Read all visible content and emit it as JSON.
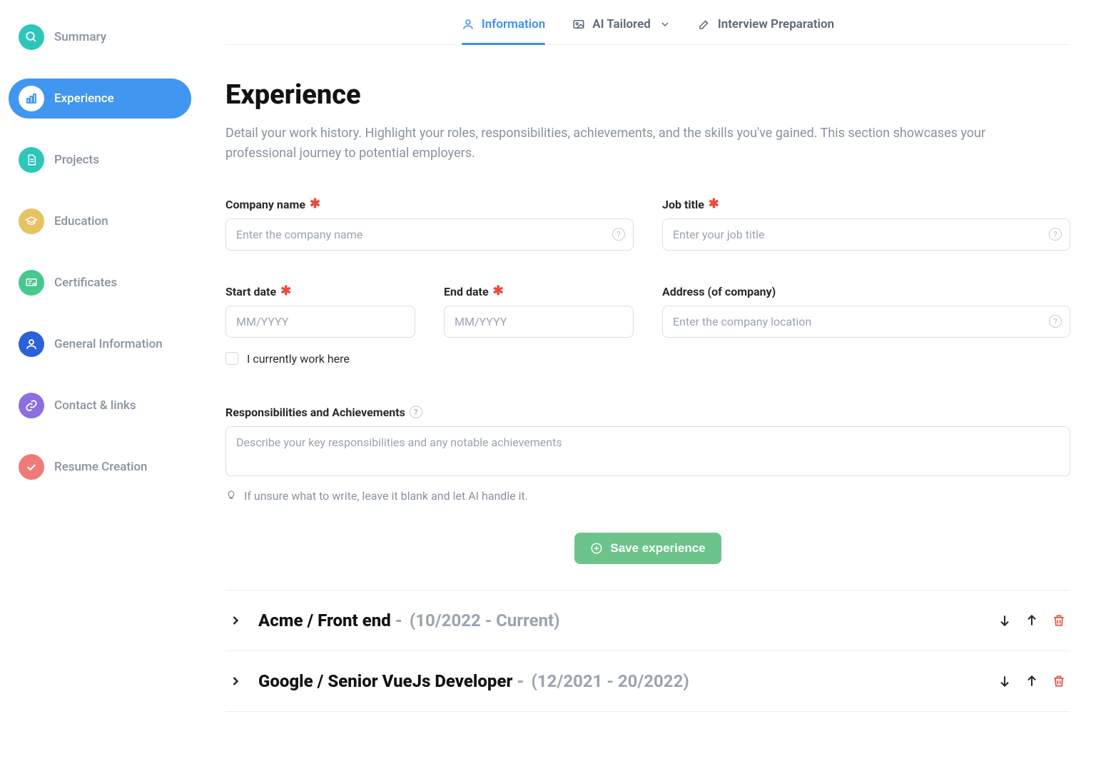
{
  "sidebar": {
    "items": [
      {
        "label": "Summary",
        "icon": "search-icon",
        "color": "bg-teal",
        "active": false
      },
      {
        "label": "Experience",
        "icon": "chart-icon",
        "color": "bg-blue",
        "active": true
      },
      {
        "label": "Projects",
        "icon": "document-icon",
        "color": "bg-teal",
        "active": false
      },
      {
        "label": "Education",
        "icon": "graduation-icon",
        "color": "bg-yellow",
        "active": false
      },
      {
        "label": "Certificates",
        "icon": "certificate-icon",
        "color": "bg-green",
        "active": false
      },
      {
        "label": "General Information",
        "icon": "person-icon",
        "color": "bg-indigo",
        "active": false
      },
      {
        "label": "Contact & links",
        "icon": "link-icon",
        "color": "bg-purple",
        "active": false
      },
      {
        "label": "Resume Creation",
        "icon": "check-icon",
        "color": "bg-coral",
        "active": false
      }
    ]
  },
  "tabs": [
    {
      "label": "Information",
      "active": true
    },
    {
      "label": "AI Tailored",
      "active": false
    },
    {
      "label": "Interview Preparation",
      "active": false
    }
  ],
  "section": {
    "title": "Experience",
    "description": "Detail your work history. Highlight your roles, responsibilities, achievements, and the skills you've gained. This section showcases your professional journey to potential employers."
  },
  "form": {
    "company_label": "Company name",
    "company_placeholder": "Enter the company name",
    "jobtitle_label": "Job title",
    "jobtitle_placeholder": "Enter your job title",
    "startdate_label": "Start date",
    "startdate_placeholder": "MM/YYYY",
    "enddate_label": "End date",
    "enddate_placeholder": "MM/YYYY",
    "address_label": "Address (of company)",
    "address_placeholder": "Enter the company location",
    "currently_work_label": "I currently work here",
    "responsibilities_label": "Responsibilities and Achievements",
    "responsibilities_placeholder": "Describe your key responsibilities and any notable achievements",
    "hint": "If unsure what to write, leave it blank and let AI handle it.",
    "save_label": "Save experience"
  },
  "experiences": [
    {
      "company": "Acme",
      "title": "Front end",
      "dates": "(10/2022 - Current)"
    },
    {
      "company": "Google",
      "title": "Senior VueJs Developer",
      "dates": "(12/2021 - 20/2022)"
    }
  ]
}
